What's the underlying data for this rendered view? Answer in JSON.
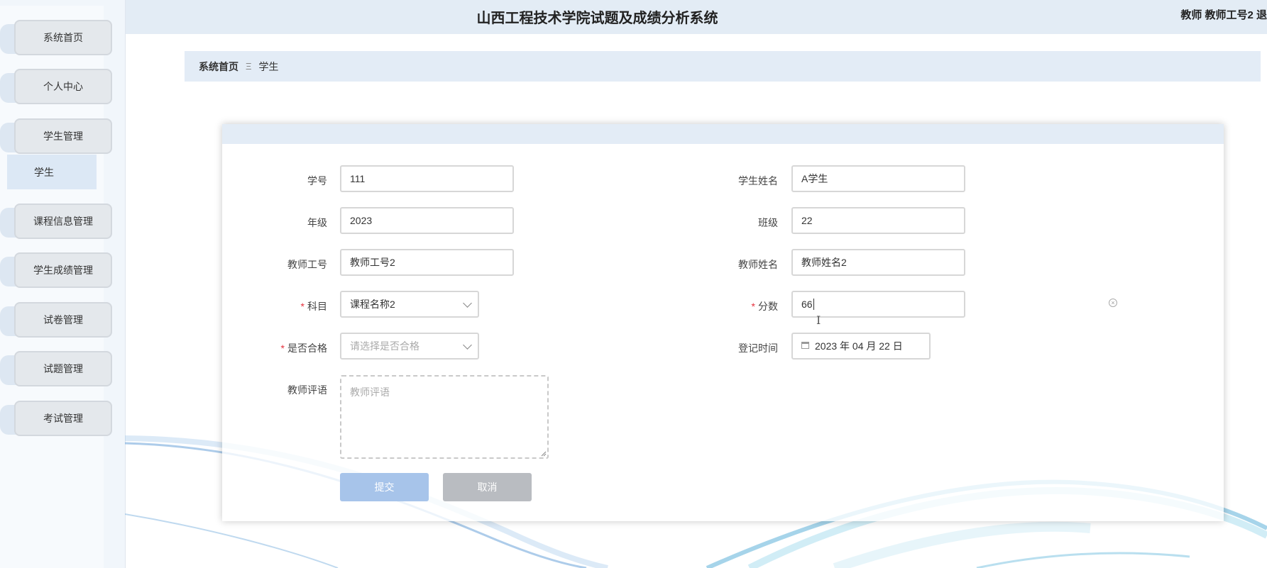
{
  "header": {
    "title": "山西工程技术学院试题及成绩分析系统",
    "user": "教师 教师工号2  退"
  },
  "sidebar": {
    "items": [
      {
        "label": "系统首页"
      },
      {
        "label": "个人中心"
      },
      {
        "label": "学生管理"
      },
      {
        "label": "课程信息管理"
      },
      {
        "label": "学生成绩管理"
      },
      {
        "label": "试卷管理"
      },
      {
        "label": "试题管理"
      },
      {
        "label": "考试管理"
      }
    ],
    "submenu": {
      "label": "学生"
    }
  },
  "breadcrumb": {
    "home": "系统首页",
    "separator": "Ξ",
    "current": "学生"
  },
  "form": {
    "student_id": {
      "label": "学号",
      "value": "111"
    },
    "student_name": {
      "label": "学生姓名",
      "value": "A学生"
    },
    "grade": {
      "label": "年级",
      "value": "2023"
    },
    "class": {
      "label": "班级",
      "value": "22"
    },
    "teacher_id": {
      "label": "教师工号",
      "value": "教师工号2"
    },
    "teacher_name": {
      "label": "教师姓名",
      "value": "教师姓名2"
    },
    "subject": {
      "label": "科目",
      "required_mark": "*",
      "value": "课程名称2"
    },
    "score": {
      "label": "分数",
      "required_mark": "*",
      "value": "66"
    },
    "passed": {
      "label": "是否合格",
      "required_mark": "*",
      "placeholder": "请选择是否合格"
    },
    "register_time": {
      "label": "登记时间",
      "value": "2023 年 04 月 22 日"
    },
    "comment": {
      "label": "教师评语",
      "placeholder": "教师评语"
    },
    "submit_label": "提交",
    "cancel_label": "取消"
  },
  "icons": {
    "clear": "clear-icon",
    "calendar": "calendar-icon",
    "dropdown": "chevron-down-icon"
  }
}
